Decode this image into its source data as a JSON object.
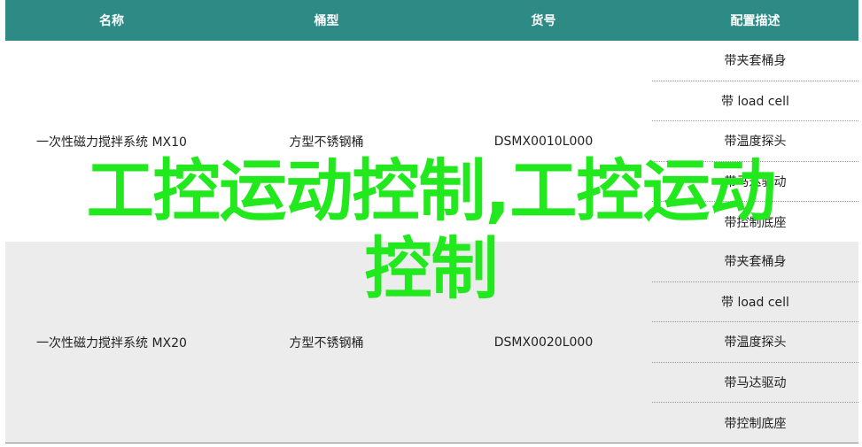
{
  "table": {
    "headers": [
      "名称",
      "桶型",
      "货号",
      "配置描述"
    ],
    "rows": [
      {
        "name": "一次性磁力搅拌系统 MX10",
        "bucket": "方型不锈钢桶",
        "sku": "DSMX0010L000",
        "configs": [
          "带夹套桶身",
          "带 load cell",
          "带温度探头",
          "带马达驱动",
          "带控制底座"
        ]
      },
      {
        "name": "一次性磁力搅拌系统 MX20",
        "bucket": "方型不锈钢桶",
        "sku": "DSMX0020L000",
        "configs": [
          "带夹套桶身",
          "带 load cell",
          "带温度探头",
          "带马达驱动",
          "带控制底座"
        ]
      }
    ]
  },
  "watermark": {
    "line1": "工控运动控制,工控运动",
    "line2": "控制",
    "color": "#22e81e"
  },
  "colors": {
    "header_bg": "#2d8a85",
    "alt_row_bg": "#ececec"
  }
}
